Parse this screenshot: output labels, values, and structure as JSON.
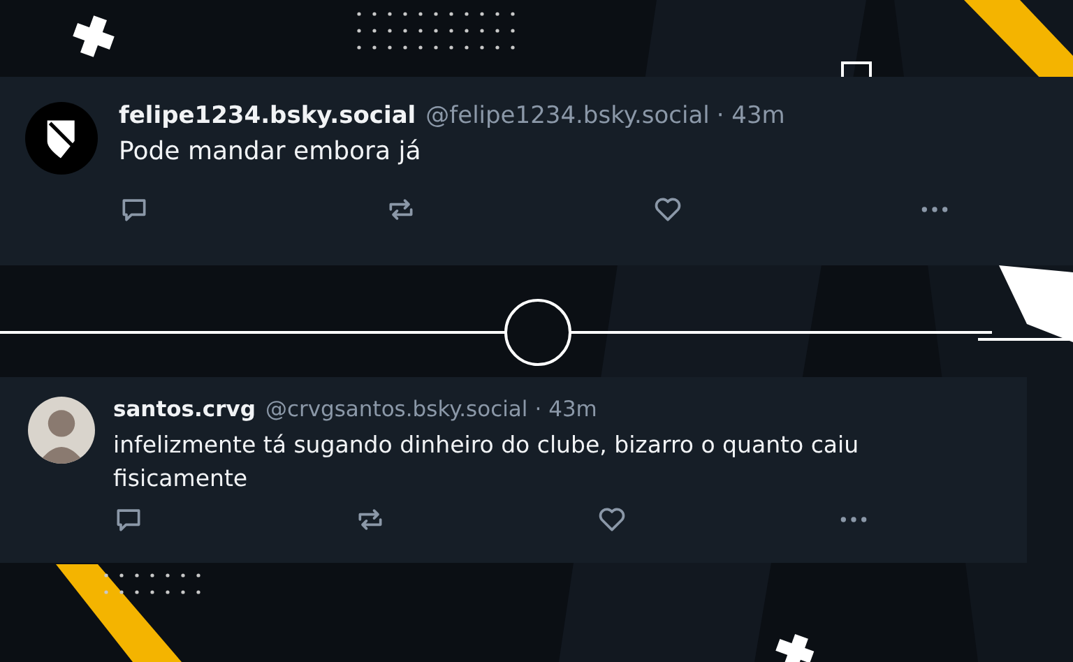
{
  "posts": [
    {
      "display_name": "felipe1234.bsky.social",
      "handle": "@felipe1234.bsky.social",
      "time": "· 43m",
      "text": "Pode mandar embora já",
      "avatar": {
        "kind": "crest"
      }
    },
    {
      "display_name": "santos.crvg",
      "handle": "@crvgsantos.bsky.social",
      "time": "· 43m",
      "text": "infelizmente tá sugando dinheiro do clube, bizarro o quanto caiu fisicamente",
      "avatar": {
        "kind": "photo"
      }
    }
  ]
}
